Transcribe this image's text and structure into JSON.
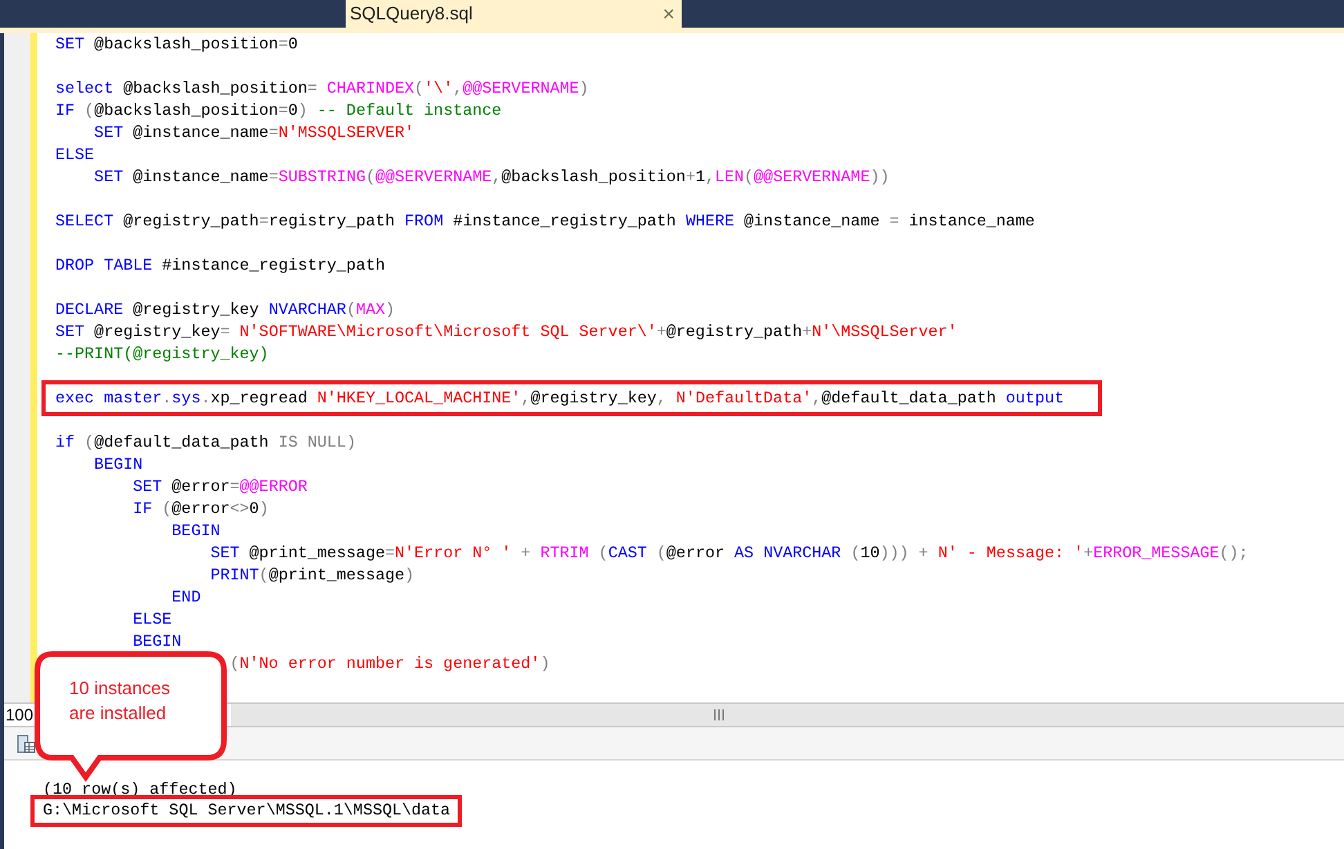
{
  "tab": {
    "title": "SQLQuery8.sql",
    "close": "×"
  },
  "editor": {
    "lines": [
      {
        "kind": "code",
        "tokens": [
          {
            "kind": "kw",
            "text": "SET"
          },
          {
            "kind": "plain",
            "text": " @backslash_position"
          },
          {
            "kind": "op",
            "text": "="
          },
          {
            "kind": "plain",
            "text": "0"
          }
        ]
      },
      {
        "kind": "blank"
      },
      {
        "kind": "code",
        "tokens": [
          {
            "kind": "kw",
            "text": "select"
          },
          {
            "kind": "plain",
            "text": " @backslash_position"
          },
          {
            "kind": "op",
            "text": "= "
          },
          {
            "kind": "fn",
            "text": "CHARINDEX"
          },
          {
            "kind": "op",
            "text": "("
          },
          {
            "kind": "str",
            "text": "'\\'"
          },
          {
            "kind": "op",
            "text": ","
          },
          {
            "kind": "fn",
            "text": "@@SERVERNAME"
          },
          {
            "kind": "op",
            "text": ")"
          }
        ]
      },
      {
        "kind": "code",
        "tokens": [
          {
            "kind": "kw",
            "text": "IF"
          },
          {
            "kind": "op",
            "text": " ("
          },
          {
            "kind": "plain",
            "text": "@backslash_position"
          },
          {
            "kind": "op",
            "text": "="
          },
          {
            "kind": "plain",
            "text": "0"
          },
          {
            "kind": "op",
            "text": ")"
          },
          {
            "kind": "cmt",
            "text": " -- Default instance"
          }
        ]
      },
      {
        "kind": "code",
        "tokens": [
          {
            "kind": "kw",
            "text": "    SET"
          },
          {
            "kind": "plain",
            "text": " @instance_name"
          },
          {
            "kind": "op",
            "text": "="
          },
          {
            "kind": "str",
            "text": "N'MSSQLSERVER'"
          }
        ]
      },
      {
        "kind": "code",
        "tokens": [
          {
            "kind": "kw",
            "text": "ELSE"
          }
        ]
      },
      {
        "kind": "code",
        "tokens": [
          {
            "kind": "kw",
            "text": "    SET"
          },
          {
            "kind": "plain",
            "text": " @instance_name"
          },
          {
            "kind": "op",
            "text": "="
          },
          {
            "kind": "fn",
            "text": "SUBSTRING"
          },
          {
            "kind": "op",
            "text": "("
          },
          {
            "kind": "fn",
            "text": "@@SERVERNAME"
          },
          {
            "kind": "op",
            "text": ","
          },
          {
            "kind": "plain",
            "text": "@backslash_position"
          },
          {
            "kind": "op",
            "text": "+"
          },
          {
            "kind": "plain",
            "text": "1"
          },
          {
            "kind": "op",
            "text": ","
          },
          {
            "kind": "fn",
            "text": "LEN"
          },
          {
            "kind": "op",
            "text": "("
          },
          {
            "kind": "fn",
            "text": "@@SERVERNAME"
          },
          {
            "kind": "op",
            "text": "))"
          }
        ]
      },
      {
        "kind": "blank"
      },
      {
        "kind": "code",
        "tokens": [
          {
            "kind": "kw",
            "text": "SELECT"
          },
          {
            "kind": "plain",
            "text": " @registry_path"
          },
          {
            "kind": "op",
            "text": "="
          },
          {
            "kind": "plain",
            "text": "registry_path "
          },
          {
            "kind": "kw",
            "text": "FROM"
          },
          {
            "kind": "plain",
            "text": " #instance_registry_path "
          },
          {
            "kind": "kw",
            "text": "WHERE"
          },
          {
            "kind": "plain",
            "text": " @instance_name "
          },
          {
            "kind": "op",
            "text": "="
          },
          {
            "kind": "plain",
            "text": " instance_name"
          }
        ]
      },
      {
        "kind": "blank"
      },
      {
        "kind": "code",
        "tokens": [
          {
            "kind": "kw",
            "text": "DROP TABLE"
          },
          {
            "kind": "plain",
            "text": " #instance_registry_path"
          }
        ]
      },
      {
        "kind": "blank"
      },
      {
        "kind": "code",
        "tokens": [
          {
            "kind": "kw",
            "text": "DECLARE"
          },
          {
            "kind": "plain",
            "text": " @registry_key "
          },
          {
            "kind": "kw",
            "text": "NVARCHAR"
          },
          {
            "kind": "op",
            "text": "("
          },
          {
            "kind": "fn",
            "text": "MAX"
          },
          {
            "kind": "op",
            "text": ")"
          }
        ]
      },
      {
        "kind": "code",
        "tokens": [
          {
            "kind": "kw",
            "text": "SET"
          },
          {
            "kind": "plain",
            "text": " @registry_key"
          },
          {
            "kind": "op",
            "text": "= "
          },
          {
            "kind": "str",
            "text": "N'SOFTWARE\\Microsoft\\Microsoft SQL Server\\'"
          },
          {
            "kind": "op",
            "text": "+"
          },
          {
            "kind": "plain",
            "text": "@registry_path"
          },
          {
            "kind": "op",
            "text": "+"
          },
          {
            "kind": "str",
            "text": "N'\\MSSQLServer'"
          }
        ]
      },
      {
        "kind": "code",
        "tokens": [
          {
            "kind": "cmt",
            "text": "--PRINT(@registry_key)"
          }
        ]
      },
      {
        "kind": "blank"
      },
      {
        "kind": "code",
        "highlighted": true,
        "tokens": [
          {
            "kind": "kw",
            "text": "exec master"
          },
          {
            "kind": "op",
            "text": "."
          },
          {
            "kind": "kw",
            "text": "sys"
          },
          {
            "kind": "op",
            "text": "."
          },
          {
            "kind": "plain",
            "text": "xp_regread "
          },
          {
            "kind": "str",
            "text": "N'HKEY_LOCAL_MACHINE'"
          },
          {
            "kind": "op",
            "text": ","
          },
          {
            "kind": "plain",
            "text": "@registry_key"
          },
          {
            "kind": "op",
            "text": ", "
          },
          {
            "kind": "str",
            "text": "N'DefaultData'"
          },
          {
            "kind": "op",
            "text": ","
          },
          {
            "kind": "plain",
            "text": "@default_data_path "
          },
          {
            "kind": "kw",
            "text": "output"
          }
        ]
      },
      {
        "kind": "blank"
      },
      {
        "kind": "code",
        "tokens": [
          {
            "kind": "kw",
            "text": "if"
          },
          {
            "kind": "op",
            "text": " ("
          },
          {
            "kind": "plain",
            "text": "@default_data_path "
          },
          {
            "kind": "op",
            "text": "IS NULL"
          },
          {
            "kind": "op",
            "text": ")"
          }
        ]
      },
      {
        "kind": "code",
        "tokens": [
          {
            "kind": "kw",
            "text": "    BEGIN"
          }
        ]
      },
      {
        "kind": "code",
        "tokens": [
          {
            "kind": "kw",
            "text": "        SET"
          },
          {
            "kind": "plain",
            "text": " @error"
          },
          {
            "kind": "op",
            "text": "="
          },
          {
            "kind": "fn",
            "text": "@@ERROR"
          }
        ]
      },
      {
        "kind": "code",
        "tokens": [
          {
            "kind": "kw",
            "text": "        IF"
          },
          {
            "kind": "op",
            "text": " ("
          },
          {
            "kind": "plain",
            "text": "@error"
          },
          {
            "kind": "op",
            "text": "<>"
          },
          {
            "kind": "plain",
            "text": "0"
          },
          {
            "kind": "op",
            "text": ")"
          }
        ]
      },
      {
        "kind": "code",
        "tokens": [
          {
            "kind": "kw",
            "text": "            BEGIN"
          }
        ]
      },
      {
        "kind": "code",
        "tokens": [
          {
            "kind": "kw",
            "text": "                SET"
          },
          {
            "kind": "plain",
            "text": " @print_message"
          },
          {
            "kind": "op",
            "text": "="
          },
          {
            "kind": "str",
            "text": "N'Error N° '"
          },
          {
            "kind": "op",
            "text": " + "
          },
          {
            "kind": "fn",
            "text": "RTRIM"
          },
          {
            "kind": "op",
            "text": " ("
          },
          {
            "kind": "kw",
            "text": "CAST"
          },
          {
            "kind": "op",
            "text": " ("
          },
          {
            "kind": "plain",
            "text": "@error "
          },
          {
            "kind": "kw",
            "text": "AS NVARCHAR"
          },
          {
            "kind": "op",
            "text": " ("
          },
          {
            "kind": "plain",
            "text": "10"
          },
          {
            "kind": "op",
            "text": "))) + "
          },
          {
            "kind": "str",
            "text": "N' - Message: '"
          },
          {
            "kind": "op",
            "text": "+"
          },
          {
            "kind": "fn",
            "text": "ERROR_MESSAGE"
          },
          {
            "kind": "op",
            "text": "();"
          }
        ]
      },
      {
        "kind": "code",
        "tokens": [
          {
            "kind": "kw",
            "text": "                PRINT"
          },
          {
            "kind": "op",
            "text": "("
          },
          {
            "kind": "plain",
            "text": "@print_message"
          },
          {
            "kind": "op",
            "text": ")"
          }
        ]
      },
      {
        "kind": "code",
        "tokens": [
          {
            "kind": "kw",
            "text": "            END"
          }
        ]
      },
      {
        "kind": "code",
        "tokens": [
          {
            "kind": "kw",
            "text": "        ELSE"
          }
        ]
      },
      {
        "kind": "code",
        "tokens": [
          {
            "kind": "kw",
            "text": "        BEGIN"
          }
        ]
      },
      {
        "kind": "code",
        "tokens": [
          {
            "kind": "op",
            "text": "                  ("
          },
          {
            "kind": "str",
            "text": "N'No error number is generated'"
          },
          {
            "kind": "op",
            "text": ")"
          }
        ]
      }
    ]
  },
  "zoom": {
    "value": "100"
  },
  "callout": {
    "text": "10 instances are installed"
  },
  "results": {
    "lines": [
      {
        "text": "(10 row(s) affected)",
        "highlighted": false
      },
      {
        "text": "G:\\Microsoft SQL Server\\MSSQL.1\\MSSQL\\data",
        "highlighted": true
      }
    ]
  }
}
